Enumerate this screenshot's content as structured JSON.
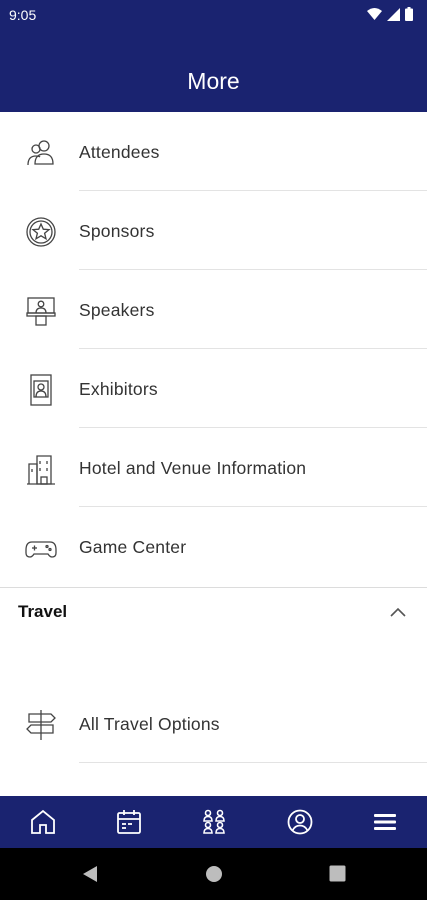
{
  "status_bar": {
    "time": "9:05"
  },
  "header": {
    "title": "More"
  },
  "menu_items": [
    {
      "label": "Attendees",
      "icon": "attendees-icon"
    },
    {
      "label": "Sponsors",
      "icon": "star-badge-icon"
    },
    {
      "label": "Speakers",
      "icon": "podium-icon"
    },
    {
      "label": "Exhibitors",
      "icon": "exhibitor-badge-icon"
    },
    {
      "label": "Hotel and Venue Information",
      "icon": "building-icon"
    },
    {
      "label": "Game Center",
      "icon": "gamepad-icon"
    }
  ],
  "travel_section": {
    "title": "Travel",
    "expanded": true,
    "items": [
      {
        "label": "All Travel Options",
        "icon": "signpost-icon"
      }
    ]
  },
  "bottom_nav": [
    {
      "name": "home",
      "icon": "home-icon"
    },
    {
      "name": "agenda",
      "icon": "calendar-icon"
    },
    {
      "name": "people",
      "icon": "people-icon"
    },
    {
      "name": "profile",
      "icon": "profile-icon"
    },
    {
      "name": "more",
      "icon": "menu-icon",
      "active": true
    }
  ],
  "colors": {
    "brand": "#1a2370",
    "icon": "#444444",
    "divider": "#e3e3e3"
  }
}
